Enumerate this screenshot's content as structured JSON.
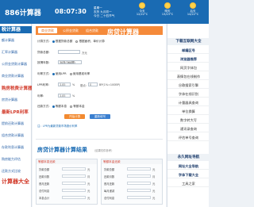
{
  "header": {
    "logo": "886计算器",
    "clock": "08:07:30",
    "date_lines": [
      "星期一",
      "农历 九月初一",
      "今日 二十四节气"
    ],
    "weather": [
      {
        "day": "今天",
        "temp": "12/22°C"
      },
      {
        "day": "明天",
        "temp": "13/23°C"
      },
      {
        "day": "后天",
        "temp": "14/22°C"
      }
    ],
    "accent": "#1a6bb3"
  },
  "left_nav": {
    "items": [
      {
        "label": "税计算器",
        "style": "title"
      },
      {
        "label": "额计算器",
        "style": "normal"
      },
      {
        "label": "汇率计算器",
        "style": "normal"
      },
      {
        "label": "公积金贷款计算器",
        "style": "normal"
      },
      {
        "label": "商业贷款计算器",
        "style": "normal"
      },
      {
        "label": "购房税费计算器",
        "style": "hl"
      },
      {
        "label": "房贷计算器",
        "style": "normal"
      },
      {
        "label": "最新LPR利率",
        "style": "hl"
      },
      {
        "label": "提前还款计算器",
        "style": "normal"
      },
      {
        "label": "组合贷款计算器",
        "style": "normal"
      },
      {
        "label": "存款利息计算器",
        "style": "normal"
      },
      {
        "label": "购房能力评估",
        "style": "normal"
      },
      {
        "label": "还款方式比较",
        "style": "normal"
      },
      {
        "label": "计算器大全",
        "style": "big"
      }
    ]
  },
  "calculator": {
    "tabs": [
      "商业贷款",
      "公积金贷款",
      "组合贷款"
    ],
    "title": "房贷计算器",
    "calc_mode_label": "计算方式:",
    "calc_modes": [
      "根据贷款总额",
      "根据面积、单价计算"
    ],
    "loan_total_label": "贷款总额:",
    "loan_total_unit": "万元",
    "loan_term_label": "按揭年数:",
    "loan_term_value": "30年(360期)",
    "rate_mode_label": "利率方式:",
    "rate_modes": [
      "使用LPR",
      "使用基准利率"
    ],
    "lpr_label": "LPR利率:",
    "lpr_value": "3.85",
    "lpr_unit": "%",
    "base_point_label": "基点:",
    "base_point_value": "0",
    "base_point_unit": "BP(1%=100BP)",
    "rate_label": "利率:",
    "rate_value": "3.85",
    "rate_unit": "%",
    "repay_label": "还款方式:",
    "repay_modes": [
      "等额本息",
      "等额本金"
    ],
    "calc_button": "开始计算",
    "reset_button": "重新填写",
    "note": "注：LPR为最新贷款市场报价利率",
    "result_title": "房贷计算器计算结果",
    "result_subtitle": "（结果仅供参考）",
    "result_left": {
      "head": "等额本息还款",
      "rows": [
        {
          "label": "贷款总额",
          "unit": "元"
        },
        {
          "label": "还款月数",
          "unit": "月"
        },
        {
          "label": "首月还款",
          "unit": "元"
        },
        {
          "label": "总付利息",
          "unit": "元"
        },
        {
          "label": "本息合计",
          "unit": "元"
        }
      ]
    },
    "result_right": {
      "head": "等额本金还款",
      "rows": [
        {
          "label": "贷款总额",
          "unit": "元"
        },
        {
          "label": "还款月数",
          "unit": "月"
        },
        {
          "label": "首月还款",
          "unit": "元"
        },
        {
          "label": "每月递减",
          "unit": "元"
        },
        {
          "label": "总付利息",
          "unit": "元"
        }
      ]
    },
    "accent": "#f58a3a"
  },
  "right_nav": {
    "section1": "下载互联网大全",
    "items1": [
      "邮编区号",
      "浏览器推荐",
      "网页字体包",
      "表情包在线制作",
      "谷歌搜索引擎",
      "字体在线识别",
      "计量器具查询",
      "单位换算",
      "数字转大写",
      "通讯录查询",
      "评估单号查询"
    ],
    "section2": "永久网址导航",
    "items2": [
      "网址大全导航",
      "字体下载大全",
      "工具之家"
    ]
  }
}
